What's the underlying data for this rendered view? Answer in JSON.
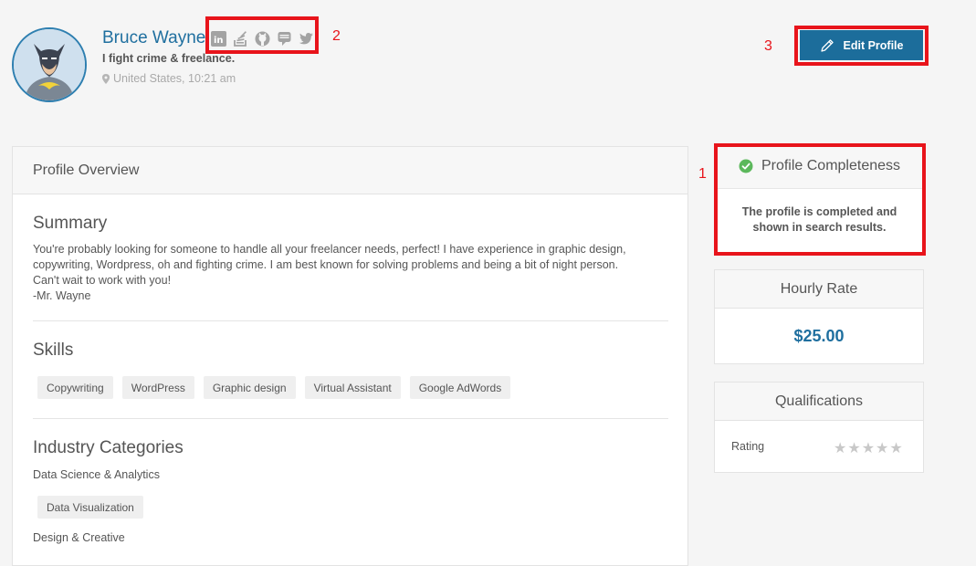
{
  "profile": {
    "name": "Bruce Wayne",
    "tagline": "I fight crime & freelance.",
    "location": "United States, 10:21 am",
    "social": [
      {
        "name": "linkedin",
        "glyph": "in"
      },
      {
        "name": "stackoverflow",
        "glyph": ""
      },
      {
        "name": "github",
        "glyph": ""
      },
      {
        "name": "stackexchange",
        "glyph": ""
      },
      {
        "name": "twitter",
        "glyph": ""
      }
    ]
  },
  "actions": {
    "edit_label": "Edit Profile"
  },
  "annotations": {
    "one": "1",
    "two": "2",
    "three": "3"
  },
  "overview": {
    "title": "Profile Overview",
    "summary_heading": "Summary",
    "summary_lines": [
      "You're probably looking for someone to handle all your freelancer needs, perfect! I have experience in graphic design,",
      "copywriting, Wordpress, oh and fighting crime. I am best known for solving problems and being a bit of night person.",
      "Can't wait to work with you!",
      "-Mr. Wayne"
    ],
    "skills_heading": "Skills",
    "skills": [
      "Copywriting",
      "WordPress",
      "Graphic design",
      "Virtual Assistant",
      "Google AdWords"
    ],
    "industry_heading": "Industry Categories",
    "categories": [
      {
        "name": "Data Science & Analytics",
        "tags": [
          "Data Visualization"
        ]
      },
      {
        "name": "Design & Creative",
        "tags": []
      }
    ]
  },
  "completeness": {
    "title": "Profile Completeness",
    "line1": "The profile is completed and",
    "line2": "shown in search results."
  },
  "hourly": {
    "title": "Hourly Rate",
    "value": "$25.00"
  },
  "qualifications": {
    "title": "Qualifications",
    "rating_label": "Rating",
    "rating_stars": 0,
    "rating_max": 5
  },
  "colors": {
    "accent": "#1c6d9b",
    "link": "#1f6f9f",
    "success": "#5cb85c",
    "annotation": "#e8141b"
  }
}
